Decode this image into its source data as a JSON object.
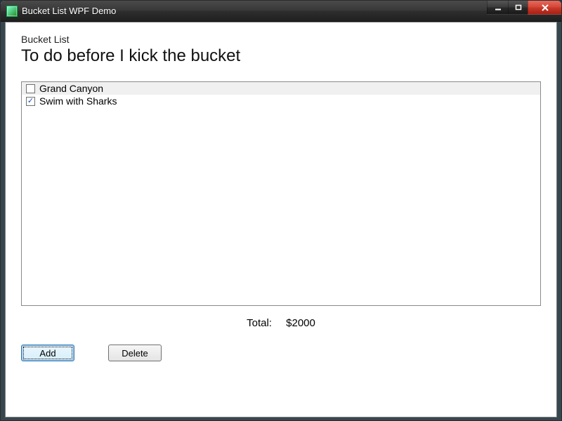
{
  "window": {
    "title": "Bucket List WPF Demo"
  },
  "header": {
    "small": "Bucket List",
    "large": "To do before I kick the bucket"
  },
  "list": {
    "items": [
      {
        "label": "Grand Canyon",
        "checked": false,
        "selected": true
      },
      {
        "label": "Swim with Sharks",
        "checked": true,
        "selected": false
      }
    ]
  },
  "total": {
    "label": "Total:",
    "value": "$2000"
  },
  "buttons": {
    "add": "Add",
    "delete": "Delete"
  }
}
